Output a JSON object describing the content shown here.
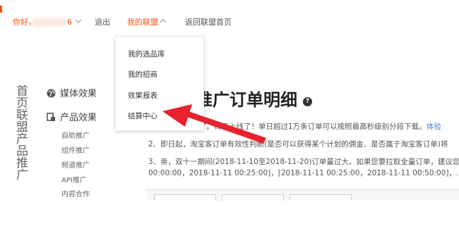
{
  "topbar": {
    "hello": "你好，",
    "username_tail": "6",
    "logout": "退出",
    "my_union": "我的联盟",
    "back_home": "返回联盟首页"
  },
  "dropdown": {
    "items": [
      "我的选品库",
      "我的招商",
      "效果报表",
      "结算中心"
    ]
  },
  "sidebar": {
    "vertical_text": "首页联盟产品推广",
    "media": "媒体效果",
    "product": "产品效果",
    "sub_items": [
      "自助推广",
      "组件推广",
      "频道推广",
      "API推广",
      "内容合作"
    ]
  },
  "main": {
    "title_partial": "客推广订单明细",
    "line1_text": "了。终于上线了！单日超过1万条订单可以按照最高秒级别分段下载。",
    "line1_link": "体验",
    "line2": "2、即日起，淘宝客订单有效性判断(是否可以获得某个计划的佣金、是否属于淘宝客订单)将",
    "line3": "3、亲，双十一期间(2018-11-10至2018-11-20)订单量过大。如果您要拉取全量订单，建议您",
    "line4": "00:00:00，2018-11-11 00:25:00]，[2018-11-11 00:25:00，2018-11-11 00:50:00]，...多个"
  },
  "colors": {
    "accent": "#ff5000",
    "arrow": "#e8222f",
    "link": "#3d7dcc"
  }
}
